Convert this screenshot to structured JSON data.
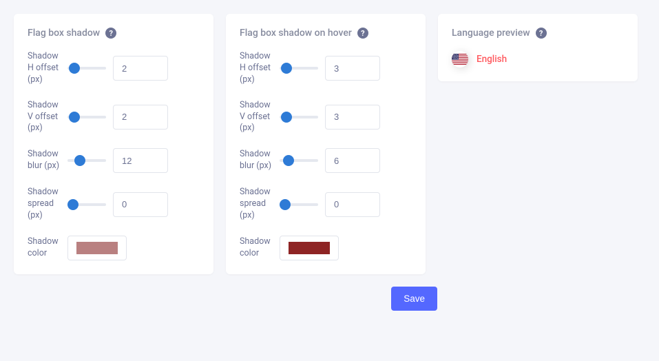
{
  "card1": {
    "title": "Flag box shadow",
    "controls": [
      {
        "label": "Shadow H offset (px)",
        "value": "2"
      },
      {
        "label": "Shadow V offset (px)",
        "value": "2"
      },
      {
        "label": "Shadow blur (px)",
        "value": "12"
      },
      {
        "label": "Shadow spread (px)",
        "value": "0"
      }
    ],
    "color_label": "Shadow color",
    "color_value": "#b98080"
  },
  "card2": {
    "title": "Flag box shadow on hover",
    "controls": [
      {
        "label": "Shadow H offset (px)",
        "value": "3"
      },
      {
        "label": "Shadow V offset (px)",
        "value": "3"
      },
      {
        "label": "Shadow blur (px)",
        "value": "6"
      },
      {
        "label": "Shadow spread (px)",
        "value": "0"
      }
    ],
    "color_label": "Shadow color",
    "color_value": "#8e2424"
  },
  "preview": {
    "title": "Language preview",
    "language": "English"
  },
  "buttons": {
    "save": "Save"
  }
}
